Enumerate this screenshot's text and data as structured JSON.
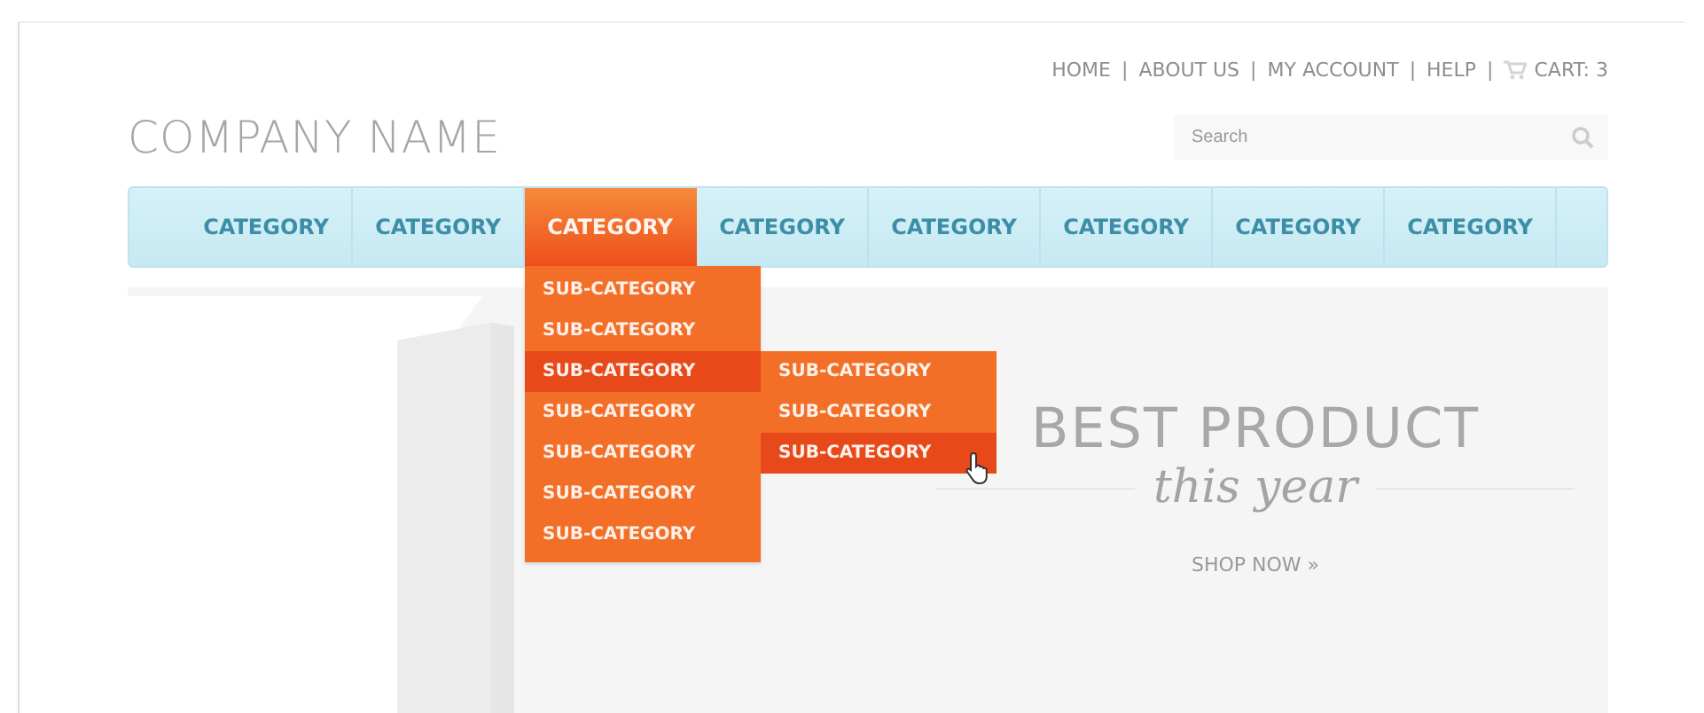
{
  "top_links": [
    {
      "label": "HOME",
      "kind": "text"
    },
    {
      "label": "ABOUT US",
      "kind": "text"
    },
    {
      "label": "MY ACCOUNT",
      "kind": "text"
    },
    {
      "label": "HELP",
      "kind": "text"
    },
    {
      "label": "CART: 3",
      "kind": "cart"
    }
  ],
  "separator": "|",
  "logo": "COMPANY NAME",
  "search": {
    "placeholder": "Search"
  },
  "nav": [
    {
      "label": "CATEGORY",
      "selected": false
    },
    {
      "label": "CATEGORY",
      "selected": false
    },
    {
      "label": "CATEGORY",
      "selected": true,
      "expanded": true,
      "children": [
        {
          "label": "SUB-CATEGORY",
          "selected": false
        },
        {
          "label": "SUB-CATEGORY",
          "selected": false
        },
        {
          "label": "SUB-CATEGORY",
          "selected": true,
          "expanded": true,
          "children": [
            {
              "label": "SUB-CATEGORY",
              "selected": false
            },
            {
              "label": "SUB-CATEGORY",
              "selected": false
            },
            {
              "label": "SUB-CATEGORY",
              "selected": true
            }
          ]
        },
        {
          "label": "SUB-CATEGORY",
          "selected": false
        },
        {
          "label": "SUB-CATEGORY",
          "selected": false
        },
        {
          "label": "SUB-CATEGORY",
          "selected": false
        },
        {
          "label": "SUB-CATEGORY",
          "selected": false
        }
      ]
    },
    {
      "label": "CATEGORY",
      "selected": false
    },
    {
      "label": "CATEGORY",
      "selected": false
    },
    {
      "label": "CATEGORY",
      "selected": false
    },
    {
      "label": "CATEGORY",
      "selected": false
    },
    {
      "label": "CATEGORY",
      "selected": false
    }
  ],
  "hero": {
    "heading": "BEST PRODUCT",
    "script": "this year",
    "link": "SHOP NOW »"
  }
}
